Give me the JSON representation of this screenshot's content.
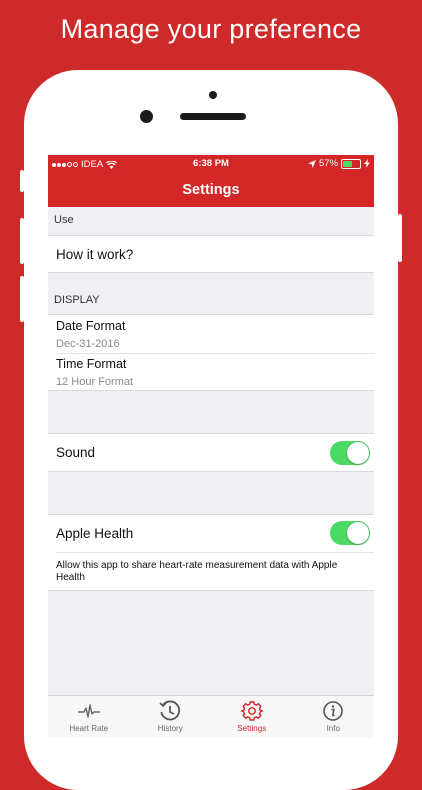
{
  "headline": "Manage your preference",
  "status": {
    "carrier": "IDEA",
    "time": "6:38 PM",
    "battery_percent": "57%",
    "battery_level": 0.57,
    "signal_bars_filled": 3,
    "signal_bars_total": 5
  },
  "nav": {
    "title": "Settings"
  },
  "sections": {
    "use_header": "Use",
    "how_it_works": "How it work?",
    "display_header": "DISPLAY",
    "date_format_label": "Date Format",
    "date_format_value": "Dec-31-2016",
    "time_format_label": "Time Format",
    "time_format_value": "12 Hour Format",
    "sound_label": "Sound",
    "sound_on": true,
    "apple_health_label": "Apple Health",
    "apple_health_on": true,
    "apple_health_desc": "Allow this app to share heart-rate measurement data with Apple Health"
  },
  "tabs": [
    {
      "label": "Heart Rate",
      "icon": "heartbeat-icon",
      "active": false
    },
    {
      "label": "History",
      "icon": "clock-history-icon",
      "active": false
    },
    {
      "label": "Settings",
      "icon": "gear-icon",
      "active": true
    },
    {
      "label": "Info",
      "icon": "info-icon",
      "active": false
    }
  ],
  "colors": {
    "brand_red": "#d32626",
    "toggle_green": "#4cd964",
    "background": "#cf2a2a"
  }
}
